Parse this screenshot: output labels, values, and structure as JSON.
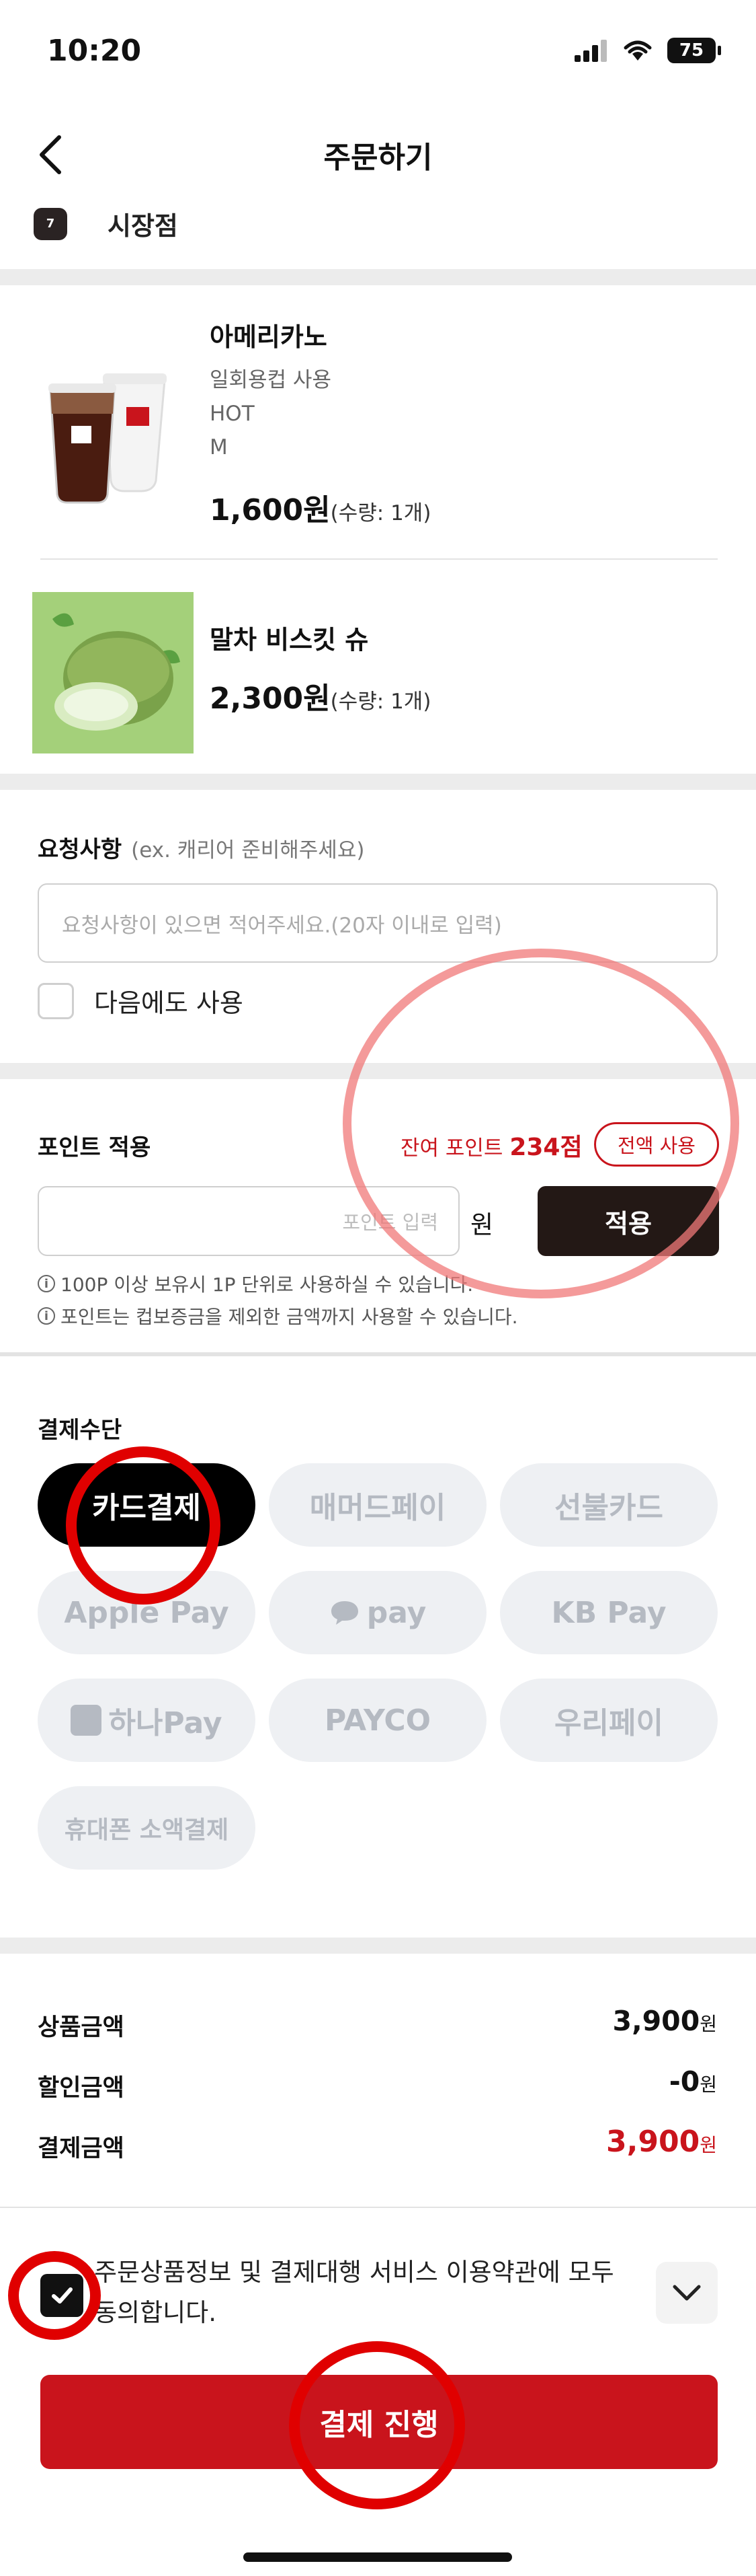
{
  "status_bar": {
    "time": "10:20",
    "battery": "75"
  },
  "header": {
    "title": "주문하기"
  },
  "store": {
    "logo_text": "7ELEVEN",
    "name": "시장점"
  },
  "products": [
    {
      "name": "아메리카노",
      "options": [
        "일회용컵 사용",
        "HOT",
        "M"
      ],
      "price": "1,600원",
      "qty": "(수량: 1개)"
    },
    {
      "name": "말차 비스킷 슈",
      "options": [],
      "price": "2,300원",
      "qty": "(수량: 1개)"
    }
  ],
  "request": {
    "label": "요청사항",
    "hint": "(ex. 캐리어 준비해주세요)",
    "placeholder": "요청사항이 있으면 적어주세요.(20자 이내로 입력)",
    "remember_label": "다음에도 사용"
  },
  "points": {
    "label": "포인트 적용",
    "remain_prefix": "잔여 포인트 ",
    "remain_value": "234점",
    "use_all": "전액 사용",
    "input_placeholder": "포인트 입력",
    "unit": "원",
    "apply": "적용",
    "notices": [
      "100P 이상 보유시 1P 단위로 사용하실 수 있습니다.",
      "포인트는 컵보증금을 제외한 금액까지 사용할 수 있습니다."
    ]
  },
  "payment": {
    "label": "결제수단",
    "methods": [
      "카드결제",
      "매머드페이",
      "선불카드",
      "Apple Pay",
      "pay",
      "KB Pay",
      "하나Pay",
      "PAYCO",
      "우리페이",
      "휴대폰 소액결제"
    ],
    "selected": "카드결제"
  },
  "amounts": {
    "items": [
      {
        "label": "상품금액",
        "value": "3,900",
        "unit": "원"
      },
      {
        "label": "할인금액",
        "value": "-0",
        "unit": "원"
      },
      {
        "label": "결제금액",
        "value": "3,900",
        "unit": "원"
      }
    ]
  },
  "agreement": {
    "text": "주문상품정보 및 결제대행 서비스 이용약관에 모두 동의합니다.",
    "checked": true
  },
  "submit": {
    "label": "결제 진행"
  },
  "colors": {
    "accent": "#c9141c",
    "dark": "#231815",
    "chip_bg": "#eef0f3"
  }
}
